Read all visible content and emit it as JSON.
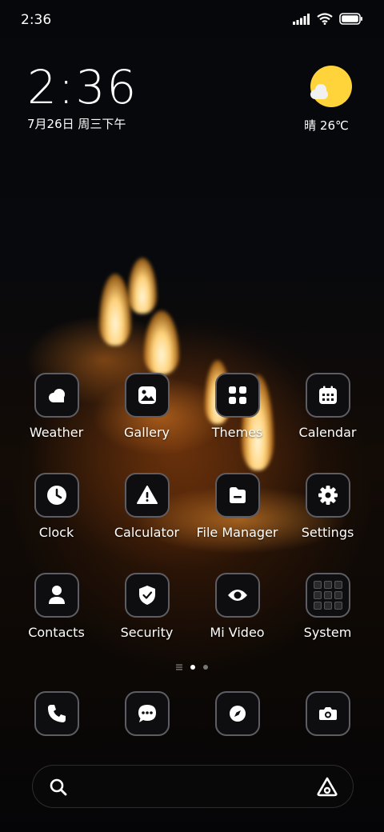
{
  "status_bar": {
    "time": "2:36",
    "icons": [
      "signal-icon",
      "wifi-icon",
      "battery-icon"
    ]
  },
  "clock_widget": {
    "time": "2:36",
    "date": "7月26日 周三下午"
  },
  "weather_widget": {
    "icon": "sun-cloud-icon",
    "text": "晴 26℃"
  },
  "apps": [
    {
      "label": "Weather",
      "icon": "weather-icon"
    },
    {
      "label": "Gallery",
      "icon": "gallery-icon"
    },
    {
      "label": "Themes",
      "icon": "themes-icon"
    },
    {
      "label": "Calendar",
      "icon": "calendar-icon"
    },
    {
      "label": "Clock",
      "icon": "clock-icon"
    },
    {
      "label": "Calculator",
      "icon": "calculator-icon"
    },
    {
      "label": "File Manager",
      "icon": "folder-icon"
    },
    {
      "label": "Settings",
      "icon": "gear-icon"
    },
    {
      "label": "Contacts",
      "icon": "person-icon"
    },
    {
      "label": "Security",
      "icon": "shield-icon"
    },
    {
      "label": "Mi Video",
      "icon": "eye-icon"
    },
    {
      "label": "System",
      "icon": "folder-grid-icon"
    }
  ],
  "page_indicator": {
    "pages": 2,
    "current": 1
  },
  "dock": [
    {
      "icon": "phone-icon"
    },
    {
      "icon": "message-icon"
    },
    {
      "icon": "compass-icon"
    },
    {
      "icon": "camera-icon"
    }
  ],
  "search_bar": {
    "left_icon": "search-icon",
    "right_icon": "assistant-icon"
  }
}
